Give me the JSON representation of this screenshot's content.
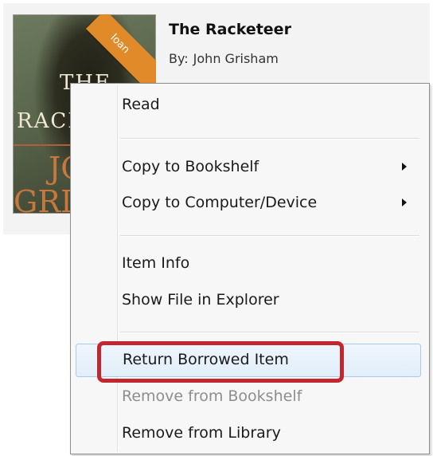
{
  "book": {
    "title": "The Racketeer",
    "author_prefix": "By:",
    "author": "John Grisham",
    "badge": "loan",
    "cover_title_line1": "THE",
    "cover_title_line2": "RACKETEER",
    "cover_author_line1": "JOHN",
    "cover_author_line2": "GRISHAM"
  },
  "menu": {
    "read": "Read",
    "copy_to_bookshelf": "Copy to Bookshelf",
    "copy_to_computer": "Copy to Computer/Device",
    "item_info": "Item Info",
    "show_file": "Show File in Explorer",
    "return_borrowed": "Return Borrowed Item",
    "remove_bookshelf": "Remove from Bookshelf",
    "remove_library": "Remove from Library"
  },
  "colors": {
    "highlight_border": "#c2262e",
    "loan_badge": "#e08a2a",
    "hover_background": "#e6f0fa"
  }
}
